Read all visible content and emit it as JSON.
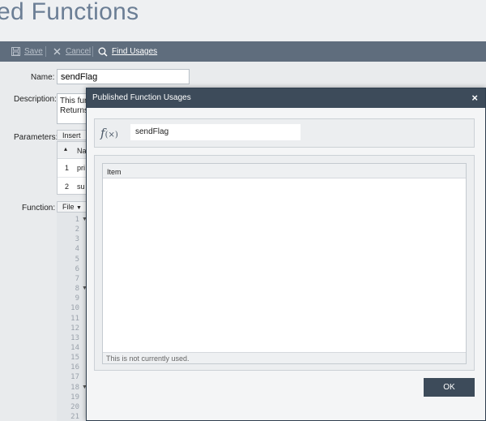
{
  "page": {
    "title": "ed Functions"
  },
  "toolbar": {
    "save_label": "Save",
    "cancel_label": "Cancel",
    "find_usages_label": "Find Usages"
  },
  "form": {
    "name_label": "Name:",
    "name_value": "sendFlag",
    "description_label": "Description:",
    "description_lines": [
      "This fur",
      "Returns"
    ],
    "parameters_label": "Parameters:",
    "insert_label": "Insert",
    "param_col_name": "Na",
    "params": [
      {
        "index": "1",
        "name": "pri"
      },
      {
        "index": "2",
        "name": "su"
      }
    ],
    "function_label": "Function:",
    "file_menu_label": "File",
    "line_numbers": [
      "1",
      "2",
      "3",
      "4",
      "5",
      "6",
      "7",
      "8",
      "9",
      "10",
      "11",
      "12",
      "13",
      "14",
      "15",
      "16",
      "17",
      "18",
      "19",
      "20",
      "21"
    ]
  },
  "modal": {
    "title": "Published Function Usages",
    "function_name": "sendFlag",
    "column_item": "Item",
    "empty_message": "This is not currently used.",
    "ok_label": "OK"
  }
}
